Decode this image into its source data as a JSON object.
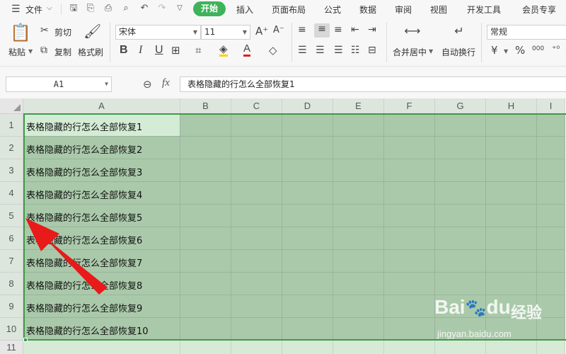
{
  "menubar": {
    "file": "文件",
    "tabs": [
      "开始",
      "插入",
      "页面布局",
      "公式",
      "数据",
      "审阅",
      "视图",
      "开发工具",
      "会员专享"
    ]
  },
  "ribbon": {
    "paste": "粘贴",
    "cut": "剪切",
    "copy": "复制",
    "format_painter": "格式刷",
    "font_name": "宋体",
    "font_size": "11",
    "merge_center": "合并居中",
    "wrap_text": "自动换行",
    "number_format": "常规",
    "currency_symbol": "¥",
    "percent_symbol": "%",
    "decimal_glyph": "000"
  },
  "formula_bar": {
    "name_box": "A1",
    "fx_label": "fx",
    "content": "表格隐藏的行怎么全部恢复1"
  },
  "grid": {
    "columns": [
      "A",
      "B",
      "C",
      "D",
      "E",
      "F",
      "G",
      "H",
      "I"
    ],
    "rows": [
      "1",
      "2",
      "3",
      "4",
      "5",
      "6",
      "7",
      "8",
      "9",
      "10",
      "11"
    ],
    "cells_a": [
      "表格隐藏的行怎么全部恢复1",
      "表格隐藏的行怎么全部恢复2",
      "表格隐藏的行怎么全部恢复3",
      "表格隐藏的行怎么全部恢复4",
      "表格隐藏的行怎么全部恢复5",
      "表格隐藏的行怎么全部恢复6",
      "表格隐藏的行怎么全部恢复7",
      "表格隐藏的行怎么全部恢复8",
      "表格隐藏的行怎么全部恢复9",
      "表格隐藏的行怎么全部恢复10"
    ]
  },
  "watermark": {
    "brand": "Bai",
    "brand2": "du",
    "cn": "经验",
    "url": "jingyan.baidu.com"
  },
  "colors": {
    "accent": "#3fb25b",
    "selection": "#aac9aa",
    "selection_border": "#3e9a4a",
    "arrow": "#e81a1a"
  }
}
